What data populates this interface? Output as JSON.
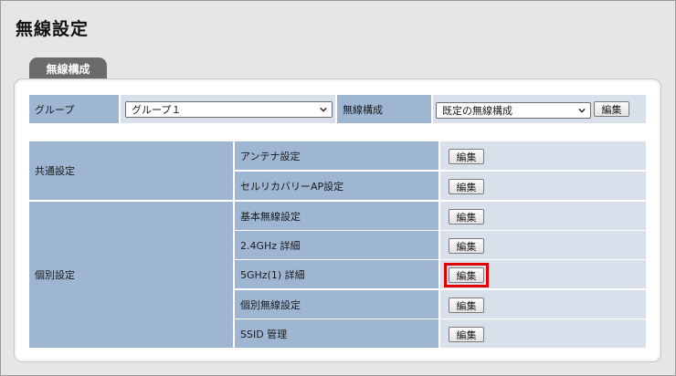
{
  "page": {
    "title": "無線設定"
  },
  "tab": {
    "label": "無線構成"
  },
  "top_row": {
    "group_label": "グループ",
    "group_select_value": "グループ１",
    "config_label": "無線構成",
    "config_select_value": "既定の無線構成",
    "edit_label": "編集"
  },
  "table": {
    "sections": [
      {
        "label": "共通設定"
      },
      {
        "label": "個別設定"
      }
    ],
    "rows": [
      {
        "name": "アンテナ設定",
        "button": "編集"
      },
      {
        "name": "セルリカバリーAP設定",
        "button": "編集"
      },
      {
        "name": "基本無線設定",
        "button": "編集"
      },
      {
        "name": "2.4GHz 詳細",
        "button": "編集"
      },
      {
        "name": "5GHz(1) 詳細",
        "button": "編集",
        "highlighted": true
      },
      {
        "name": "個別無線設定",
        "button": "編集"
      },
      {
        "name": "SSID 管理",
        "button": "編集"
      }
    ]
  },
  "colors": {
    "label_cell": "#9eb6d2",
    "value_cell": "#d8e0ec",
    "tab_bg": "#6b6b6b",
    "highlight": "#e20000"
  }
}
